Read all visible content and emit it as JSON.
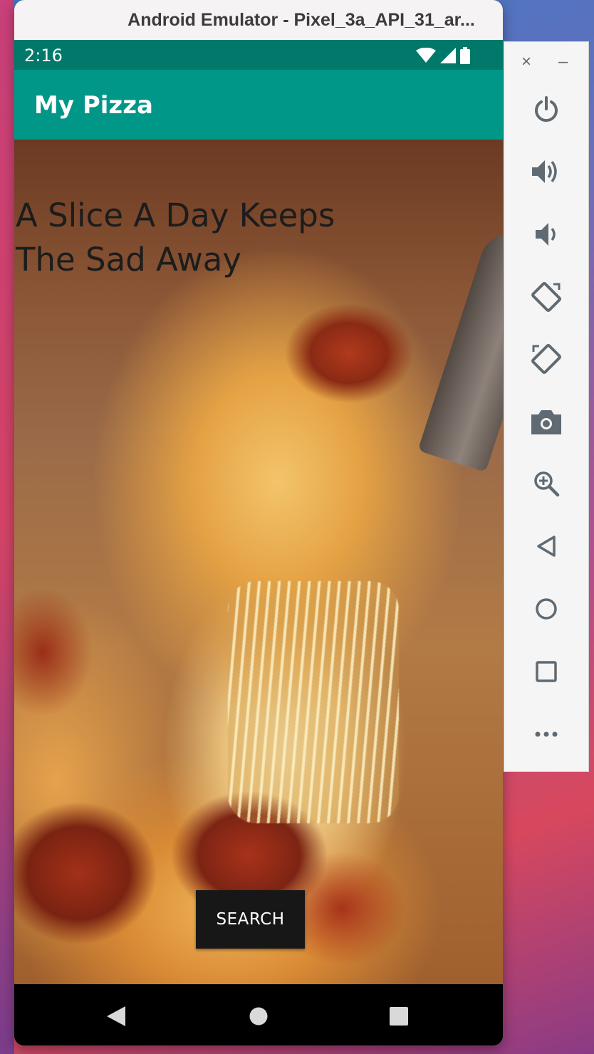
{
  "window": {
    "title": "Android Emulator - Pixel_3a_API_31_ar..."
  },
  "status_bar": {
    "time": "2:16",
    "icons": [
      "wifi-icon",
      "signal-icon",
      "battery-icon"
    ]
  },
  "app_bar": {
    "title": "My Pizza"
  },
  "main": {
    "headline": "A Slice A Day Keeps The Sad Away",
    "background_image": "pepperoni-pizza-slice-photo",
    "search_label": "SEARCH"
  },
  "nav_bar": {
    "buttons": [
      "back-icon",
      "home-icon",
      "recents-icon"
    ]
  },
  "emulator_toolbar": {
    "close": "×",
    "minimize": "–",
    "buttons": [
      "power-icon",
      "volume-up-icon",
      "volume-down-icon",
      "rotate-left-icon",
      "rotate-right-icon",
      "camera-icon",
      "zoom-icon",
      "back-icon",
      "home-icon",
      "overview-icon",
      "more-icon"
    ]
  },
  "colors": {
    "status_bar": "#00796b",
    "app_bar": "#009688",
    "button": "#171717",
    "toolbar_icon": "#5f6a72"
  }
}
